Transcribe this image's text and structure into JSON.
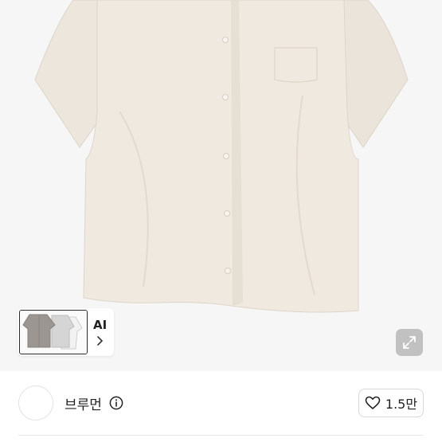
{
  "product_image": {
    "alt": "",
    "background_color": "#f6f6f6",
    "shirt_color": "#ece5db"
  },
  "ai_panel": {
    "label": "AI",
    "chevron_icon": "chevron-right-icon"
  },
  "expand_button": {
    "icon": "expand-arrows-icon"
  },
  "seller": {
    "name": "브루먼",
    "info_icon": "info-circle-icon",
    "avatar_icon": "avatar-placeholder"
  },
  "like_button": {
    "icon": "heart-outline-icon",
    "count": "1.5만"
  }
}
